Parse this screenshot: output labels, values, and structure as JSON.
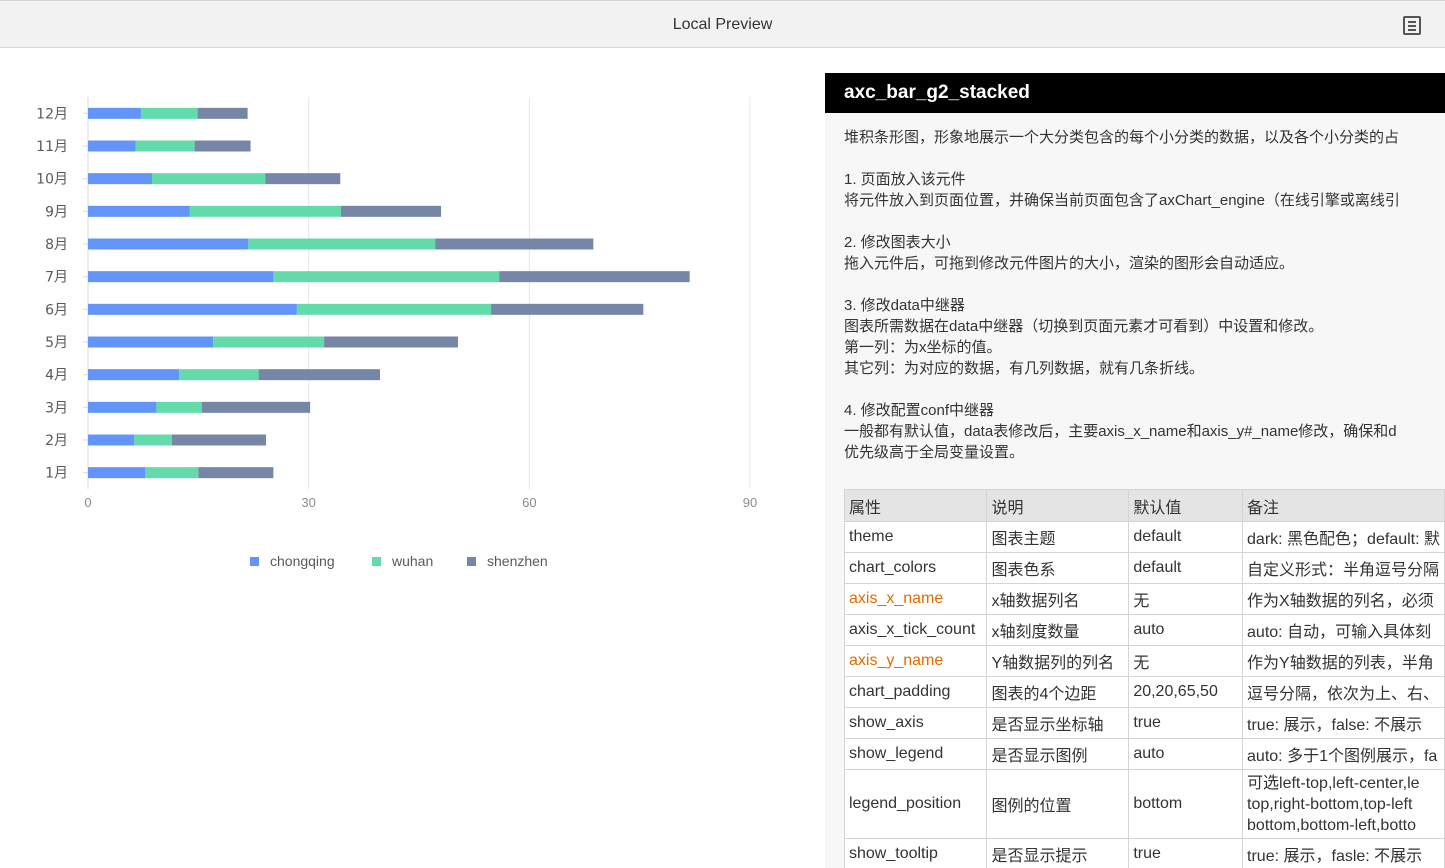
{
  "topbar": {
    "title": "Local Preview",
    "icon": "document-list-icon"
  },
  "chart_data": {
    "type": "bar",
    "orientation": "horizontal",
    "stacked": true,
    "categories": [
      "1月",
      "2月",
      "3月",
      "4月",
      "5月",
      "6月",
      "7月",
      "8月",
      "9月",
      "10月",
      "11月",
      "12月"
    ],
    "series": [
      {
        "name": "chongqing",
        "color": "#6394f9",
        "values": [
          7.8,
          6.3,
          9.3,
          12.4,
          17,
          28.4,
          25.2,
          21.8,
          13.8,
          8.7,
          6.5,
          7.2
        ]
      },
      {
        "name": "wuhan",
        "color": "#62daaa",
        "values": [
          7.2,
          5.1,
          6.2,
          10.8,
          15.1,
          26.4,
          30.7,
          25.4,
          20.6,
          15.4,
          8,
          7.7
        ]
      },
      {
        "name": "shenzhen",
        "color": "#7586a6",
        "values": [
          10.2,
          12.8,
          14.7,
          16.5,
          18.2,
          20.7,
          25.9,
          21.5,
          13.6,
          10.2,
          7.6,
          6.8
        ]
      }
    ],
    "xlim": [
      0,
      90
    ],
    "xticks": [
      "0",
      "30",
      "60",
      "90"
    ],
    "grid": true,
    "legend_position": "bottom"
  },
  "panel": {
    "title": "axc_bar_g2_stacked",
    "intro": "堆积条形图，形象地展示一个大分类包含的每个小分类的数据，以及各个小分类的占",
    "s1_title": "1. 页面放入该元件",
    "s1_text": "将元件放入到页面位置，并确保当前页面包含了axChart_engine（在线引擎或离线引",
    "s2_title": "2. 修改图表大小",
    "s2_text": "拖入元件后，可拖到修改元件图片的大小，渲染的图形会自动适应。",
    "s3_title": "3. 修改data中继器",
    "s3_text1": "图表所需数据在data中继器（切换到页面元素才可看到）中设置和修改。",
    "s3_text2": "第一列：为x坐标的值。",
    "s3_text3": "其它列：为对应的数据，有几列数据，就有几条折线。",
    "s4_title": "4. 修改配置conf中继器",
    "s4_text1": "一般都有默认值，data表修改后，主要axis_x_name和axis_y#_name修改，确保和d",
    "s4_text2": "优先级高于全局变量设置。"
  },
  "table": {
    "headers": [
      "属性",
      "说明",
      "默认值",
      "备注"
    ],
    "rows": [
      {
        "prop": "theme",
        "desc": "图表主题",
        "def": "default",
        "note": "dark: 黑色配色；default: 默",
        "hl": false
      },
      {
        "prop": "chart_colors",
        "desc": "图表色系",
        "def": "default",
        "note": "自定义形式：半角逗号分隔",
        "hl": false
      },
      {
        "prop": "axis_x_name",
        "desc": "x轴数据列名",
        "def": "无",
        "note": "作为X轴数据的列名，必须",
        "hl": true
      },
      {
        "prop": "axis_x_tick_count",
        "desc": "x轴刻度数量",
        "def": "auto",
        "note": "auto: 自动，可输入具体刻",
        "hl": false
      },
      {
        "prop": "axis_y_name",
        "desc": "Y轴数据列的列名",
        "def": "无",
        "note": "作为Y轴数据的列表，半角",
        "hl": true
      },
      {
        "prop": "chart_padding",
        "desc": "图表的4个边距",
        "def": "20,20,65,50",
        "note": "逗号分隔，依次为上、右、",
        "hl": false
      },
      {
        "prop": "show_axis",
        "desc": "是否显示坐标轴",
        "def": "true",
        "note": "true: 展示，false: 不展示",
        "hl": false
      },
      {
        "prop": "show_legend",
        "desc": "是否显示图例",
        "def": "auto",
        "note": "auto: 多于1个图例展示，fa",
        "hl": false
      },
      {
        "prop": "legend_position",
        "desc": "图例的位置",
        "def": "bottom",
        "note": "可选left-top,left-center,le top,right-bottom,top-left bottom,bottom-left,botto",
        "hl": false,
        "multi": true
      },
      {
        "prop": "show_tooltip",
        "desc": "是否显示提示",
        "def": "true",
        "note": "true: 展示，fasle: 不展示",
        "hl": false
      }
    ]
  }
}
